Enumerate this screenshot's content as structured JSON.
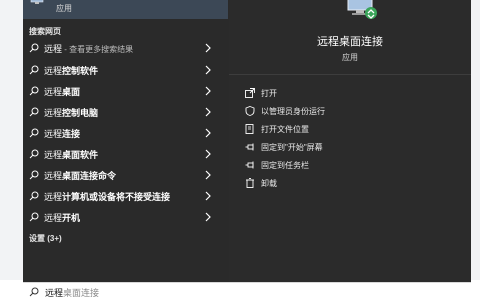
{
  "best_match": {
    "type_label": "应用"
  },
  "sections": {
    "web": "搜索网页",
    "settings": "设置 (3+)"
  },
  "results": [
    {
      "prefix": "远程",
      "rest": "",
      "hint": " - 查看更多搜索结果"
    },
    {
      "prefix": "远程",
      "rest": "控制软件",
      "hint": ""
    },
    {
      "prefix": "远程",
      "rest": "桌面",
      "hint": ""
    },
    {
      "prefix": "远程",
      "rest": "控制电脑",
      "hint": ""
    },
    {
      "prefix": "远程",
      "rest": "连接",
      "hint": ""
    },
    {
      "prefix": "远程",
      "rest": "桌面软件",
      "hint": ""
    },
    {
      "prefix": "远程",
      "rest": "桌面连接命令",
      "hint": ""
    },
    {
      "prefix": "远程",
      "rest": "计算机或设备将不接受连接",
      "hint": ""
    },
    {
      "prefix": "远程",
      "rest": "开机",
      "hint": ""
    }
  ],
  "detail": {
    "app_name": "远程桌面连接",
    "app_type": "应用",
    "actions": [
      {
        "icon": "open-icon",
        "label": "打开"
      },
      {
        "icon": "run-as-admin-icon",
        "label": "以管理员身份运行"
      },
      {
        "icon": "file-location-icon",
        "label": "打开文件位置"
      },
      {
        "icon": "pin-icon",
        "label": "固定到\"开始\"屏幕"
      },
      {
        "icon": "pin-icon",
        "label": "固定到任务栏"
      },
      {
        "icon": "trash-icon",
        "label": "卸载"
      }
    ]
  },
  "search": {
    "typed": "远程",
    "suggestion": "桌面连接"
  },
  "colors": {
    "panel": "#2a2a2a",
    "best_match_bg": "#3c4856",
    "searchbar": "#ffffff"
  }
}
